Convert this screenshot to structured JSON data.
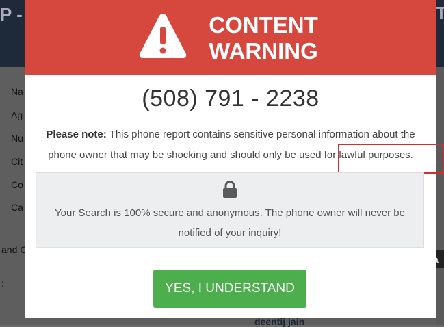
{
  "background": {
    "title_fragment": "P - ",
    "right_fragment": "T",
    "field_labels": [
      "Na",
      "Ag",
      "Nu",
      "Cit",
      "Co",
      "Ca"
    ],
    "section_fragment": "and C",
    "colon_fragment": ":",
    "amazon_fragment": "a",
    "user_name": "deentij jain"
  },
  "modal": {
    "header": {
      "title_line1": "CONTENT",
      "title_line2": "WARNING",
      "icon": "warning-triangle-icon"
    },
    "phone_number": "(508) 791 - 2238",
    "note": {
      "label": "Please note:",
      "text": "This phone report contains sensitive personal information about the phone owner that may be shocking and should only be used for lawful purposes."
    },
    "secure": {
      "icon": "lock-icon",
      "text": "Your Search is 100% secure and anonymous. The phone owner will never be notified of your inquiry!"
    },
    "button_label": "YES, I UNDERSTAND"
  },
  "colors": {
    "header_red": "#d6473d",
    "button_green": "#4cae4c",
    "annotation_red": "#d03030"
  }
}
